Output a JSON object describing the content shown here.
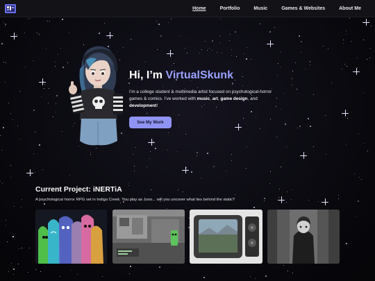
{
  "nav": {
    "logo_alt": "VirtualSkunk logo",
    "links": [
      {
        "label": "Home",
        "active": true
      },
      {
        "label": "Portfolio",
        "active": false
      },
      {
        "label": "Music",
        "active": false
      },
      {
        "label": "Games & Websites",
        "active": false
      },
      {
        "label": "About Me",
        "active": false
      }
    ]
  },
  "hero": {
    "greeting": "Hi, I’m ",
    "name": "VirtualSkunk",
    "desc_part1": "I’m a college student & multimedia artist focused on psychological-horror games & comics. I’ve worked with ",
    "desc_music": "music",
    "desc_sep1": ", ",
    "desc_art": "art",
    "desc_sep2": ", ",
    "desc_game": "game design",
    "desc_sep3": ", and ",
    "desc_dev": "development",
    "desc_end": "!",
    "button_label": "See My Work"
  },
  "project": {
    "title": "Current Project: iNERTiA",
    "description": "A psychological horror RPG set in Indigo Creek. You play as Juno... will you uncover what lies behind the static?",
    "thumbnails": [
      {
        "icon": "colorful-ghost-characters-art"
      },
      {
        "icon": "grayscale-game-screenshot"
      },
      {
        "icon": "retro-monitor-art"
      },
      {
        "icon": "grayscale-character-art"
      }
    ]
  },
  "colors": {
    "accent": "#9aa0ff",
    "button": "#8f94f4",
    "navbar": "#121217",
    "background": "#08080d"
  }
}
